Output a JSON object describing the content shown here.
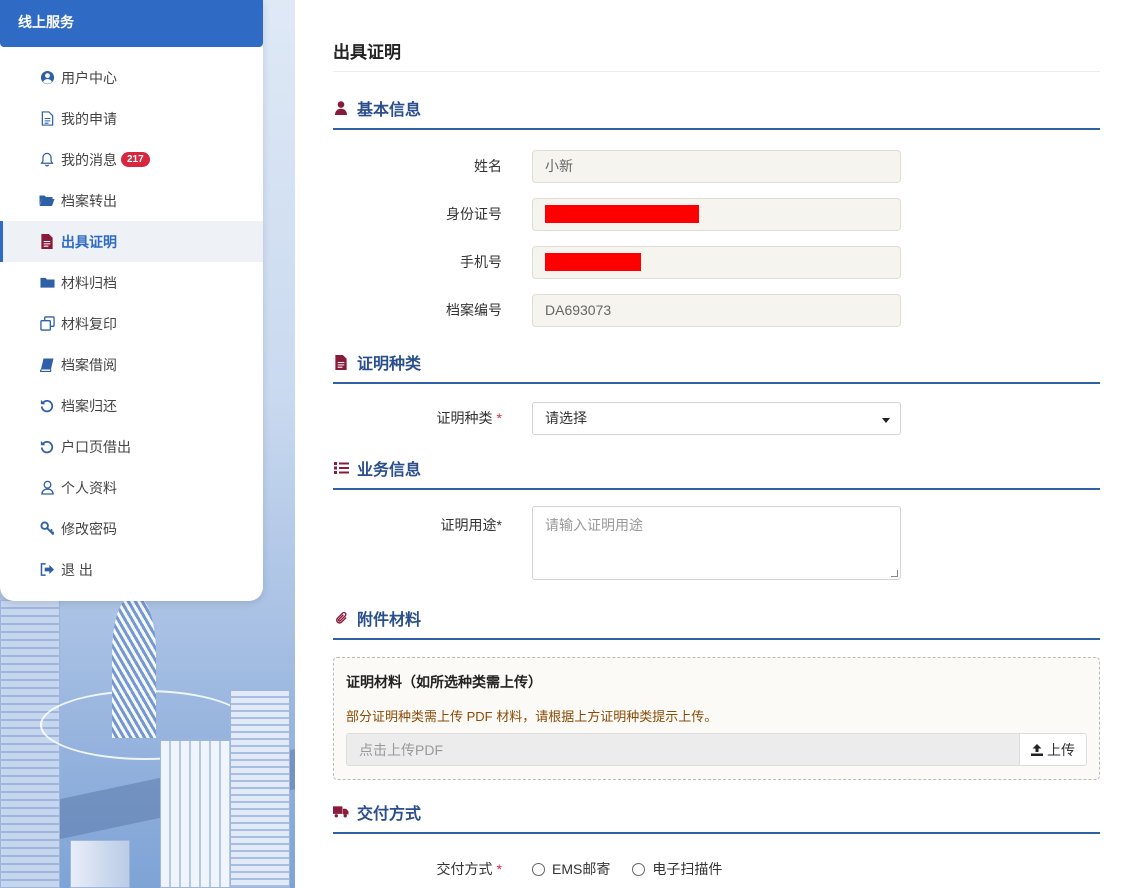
{
  "sidebar": {
    "title": "线上服务",
    "items": [
      {
        "label": "用户中心",
        "icon": "user-circle-icon"
      },
      {
        "label": "我的申请",
        "icon": "document-icon"
      },
      {
        "label": "我的消息",
        "icon": "bell-icon",
        "badge": "217"
      },
      {
        "label": "档案转出",
        "icon": "folder-open-icon"
      },
      {
        "label": "出具证明",
        "icon": "file-text-icon",
        "active": true
      },
      {
        "label": "材料归档",
        "icon": "folder-icon"
      },
      {
        "label": "材料复印",
        "icon": "copy-icon"
      },
      {
        "label": "档案借阅",
        "icon": "book-icon"
      },
      {
        "label": "档案归还",
        "icon": "undo-icon"
      },
      {
        "label": "户口页借出",
        "icon": "undo-icon"
      },
      {
        "label": "个人资料",
        "icon": "user-icon"
      },
      {
        "label": "修改密码",
        "icon": "key-icon"
      },
      {
        "label": "退 出",
        "icon": "sign-out-icon"
      }
    ]
  },
  "main": {
    "title": "出具证明",
    "sections": {
      "basic": {
        "title": "基本信息",
        "name_label": "姓名",
        "name_value": "小新",
        "id_label": "身份证号",
        "phone_label": "手机号",
        "file_label": "档案编号",
        "file_value": "DA693073"
      },
      "cert_type": {
        "title": "证明种类",
        "label": "证明种类",
        "required": "*",
        "selected": "请选择"
      },
      "business": {
        "title": "业务信息",
        "purpose_label": "证明用途",
        "required": "*",
        "purpose_placeholder": "请输入证明用途"
      },
      "attachments": {
        "title": "附件材料",
        "box_title": "证明材料（如所选种类需上传）",
        "hint": "部分证明种类需上传 PDF 材料，请根据上方证明种类提示上传。",
        "upload_placeholder": "点击上传PDF",
        "upload_button": "上传"
      },
      "delivery": {
        "title": "交付方式",
        "label": "交付方式",
        "required": "*",
        "options": [
          "EMS邮寄",
          "电子扫描件"
        ]
      }
    }
  },
  "colors": {
    "accent": "#2f6bc4",
    "section_icon": "#8a1a3a",
    "badge": "#d7263d",
    "redaction": "#ff0000"
  }
}
